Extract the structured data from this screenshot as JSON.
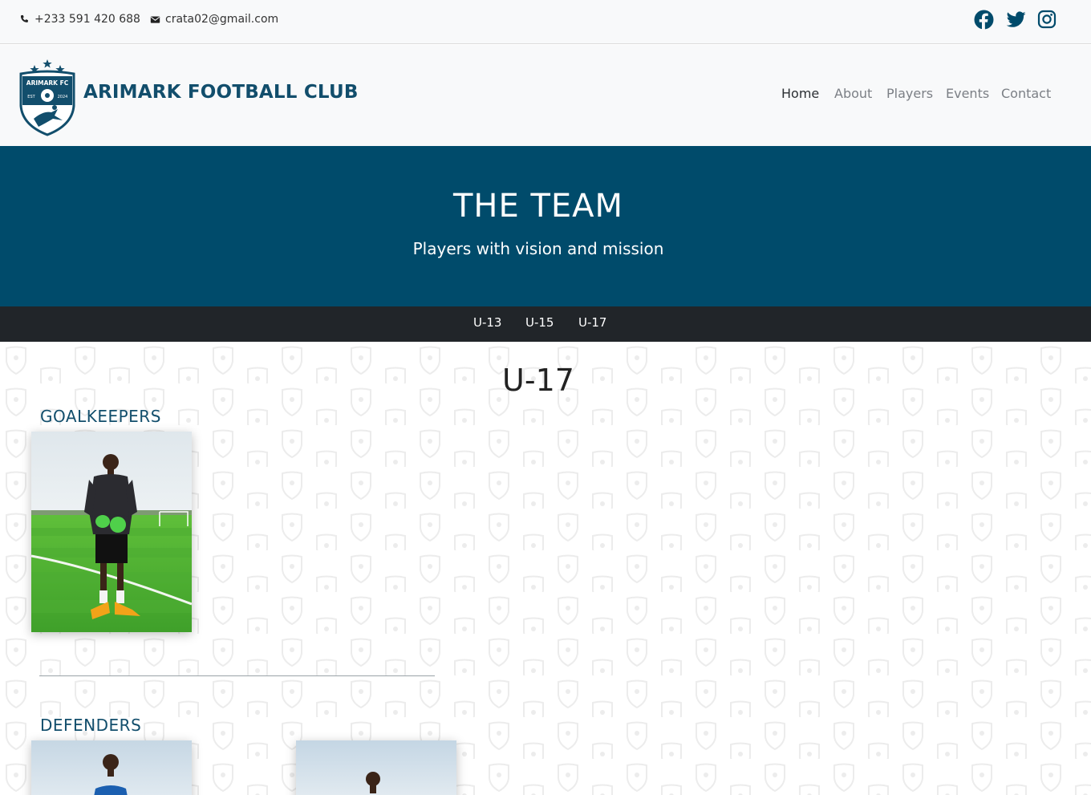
{
  "topbar": {
    "phone": "+233 591 420 688",
    "email": "crata02@gmail.com",
    "social": [
      "facebook-icon",
      "twitter-icon",
      "instagram-icon"
    ]
  },
  "header": {
    "brand": "ARIMARK FOOTBALL CLUB",
    "logo_text": {
      "name": "ARIMARK FC",
      "est": "EST",
      "year": "2024"
    },
    "nav": [
      {
        "label": "Home",
        "active": true
      },
      {
        "label": "About",
        "active": false
      },
      {
        "label": "Players",
        "active": false
      },
      {
        "label": "Events",
        "active": false
      },
      {
        "label": "Contact",
        "active": false
      }
    ]
  },
  "hero": {
    "title": "THE TEAM",
    "subtitle": "Players with vision and mission"
  },
  "age_groups": [
    "U-13",
    "U-15",
    "U-17"
  ],
  "team": {
    "title": "U-17",
    "groups": [
      {
        "heading": "GOALKEEPERS"
      },
      {
        "heading": "DEFENDERS"
      }
    ]
  },
  "colors": {
    "brand_blue": "#004b6b",
    "dark_bar": "#212529",
    "heading_blue": "#124e6c"
  }
}
